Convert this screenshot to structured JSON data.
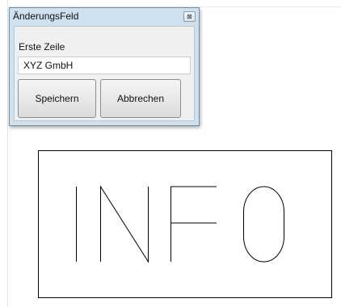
{
  "dialog": {
    "title": "ÄnderungsFeld",
    "close_glyph": "⊠",
    "field_label": "Erste Zeile",
    "field_value": "XYZ GmbH",
    "save_label": "Speichern",
    "cancel_label": "Abbrechen"
  },
  "drawing": {
    "text": "INFO",
    "stroke_color": "#000000"
  }
}
